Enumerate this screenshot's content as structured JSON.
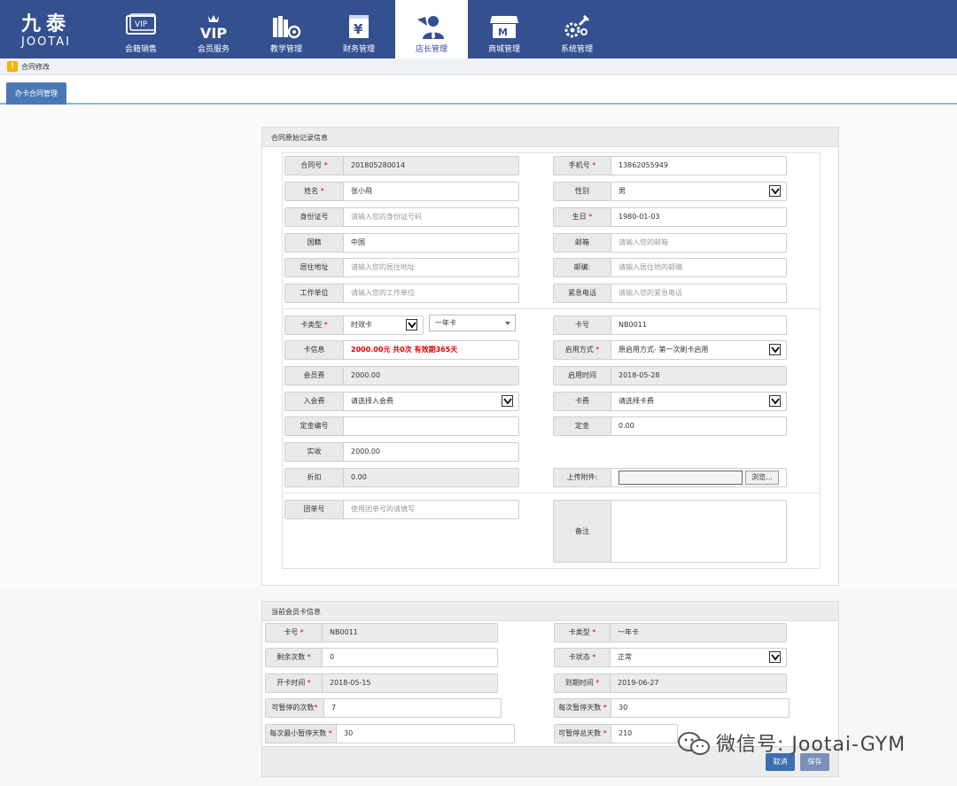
{
  "brand": {
    "logo_cn": "九泰",
    "logo_en": "JOOTAI"
  },
  "nav": [
    {
      "label": "会籍销售",
      "icon": "vip-card-icon",
      "active": false
    },
    {
      "label": "会员服务",
      "icon": "vip-icon",
      "active": false
    },
    {
      "label": "教学管理",
      "icon": "books-gear-icon",
      "active": false
    },
    {
      "label": "财务管理",
      "icon": "yen-icon",
      "active": false
    },
    {
      "label": "店长管理",
      "icon": "manager-icon",
      "active": true
    },
    {
      "label": "商城管理",
      "icon": "store-icon",
      "active": false
    },
    {
      "label": "系统管理",
      "icon": "wrench-gear-icon",
      "active": false
    }
  ],
  "breadcrumb": {
    "text": "合同修改"
  },
  "tab": {
    "label": "办卡合同管理"
  },
  "contract": {
    "title": "合同原始记录信息",
    "contract_no": {
      "label": "合同号",
      "value": "201805280014"
    },
    "phone": {
      "label": "手机号",
      "value": "13862055949"
    },
    "name": {
      "label": "姓名",
      "value": "张小飛"
    },
    "gender": {
      "label": "性别",
      "value": "男"
    },
    "id_card": {
      "label": "身份证号",
      "placeholder": "请输入您的身份证号码"
    },
    "birthday": {
      "label": "生日",
      "value": "1980-01-03"
    },
    "nationality": {
      "label": "国籍",
      "value": "中国"
    },
    "email": {
      "label": "邮箱",
      "placeholder": "请输入您的邮箱"
    },
    "address": {
      "label": "居住地址",
      "placeholder": "请输入您的居住地址"
    },
    "postcode": {
      "label": "邮编:",
      "placeholder": "请输入居住地的邮编"
    },
    "workplace": {
      "label": "工作单位",
      "placeholder": "请输入您的工作单位"
    },
    "emergency": {
      "label": "紧急电话",
      "placeholder": "请输入您的紧急电话"
    },
    "card_type": {
      "label": "卡类型",
      "value": "时效卡",
      "sub_value": "一年卡"
    },
    "card_no": {
      "label": "卡号",
      "value": "NB0011"
    },
    "card_info": {
      "label": "卡信息",
      "value": "2000.00元 共0次 有效期365天"
    },
    "enable_mode": {
      "label": "启用方式",
      "value": "原启用方式- 第一次刷卡启用"
    },
    "member_fee": {
      "label": "会员费",
      "value": "2000.00"
    },
    "enable_time": {
      "label": "启用时间",
      "value": "2018-05-28"
    },
    "join_fee": {
      "label": "入会费",
      "value": "请选择入会费"
    },
    "card_fee": {
      "label": "卡费",
      "value": "请选择卡费"
    },
    "deposit_no": {
      "label": "定金编号",
      "value": ""
    },
    "deposit": {
      "label": "定金",
      "value": "0.00"
    },
    "paid": {
      "label": "实收",
      "value": "2000.00"
    },
    "attachment": {
      "label": "上传附件:",
      "browse": "浏览..."
    },
    "discount": {
      "label": "折扣",
      "value": "0.00"
    },
    "group_no": {
      "label": "团单号",
      "placeholder": "使用团单号的请填写"
    },
    "remark": {
      "label": "备注"
    }
  },
  "card": {
    "title": "当前会员卡信息",
    "card_no": {
      "label": "卡号",
      "value": "NB0011"
    },
    "card_type": {
      "label": "卡类型",
      "value": "一年卡"
    },
    "remaining": {
      "label": "剩余次数",
      "value": "0"
    },
    "status": {
      "label": "卡状态",
      "value": "正常"
    },
    "open_time": {
      "label": "开卡时间",
      "value": "2018-05-15"
    },
    "expire_time": {
      "label": "到期时间",
      "value": "2019-06-27"
    },
    "pause_times": {
      "label": "可暂停的次数",
      "value": "7"
    },
    "pause_days_each": {
      "label": "每次暂停天数",
      "value": "30"
    },
    "min_pause_days": {
      "label": "每次最小暂停天数",
      "value": "30"
    },
    "total_pause_days": {
      "label": "可暂停总天数",
      "value": "210"
    },
    "cancel": "取消",
    "save": "保存"
  },
  "watermark": "微信号: Jootai-GYM",
  "required_mark": "*"
}
